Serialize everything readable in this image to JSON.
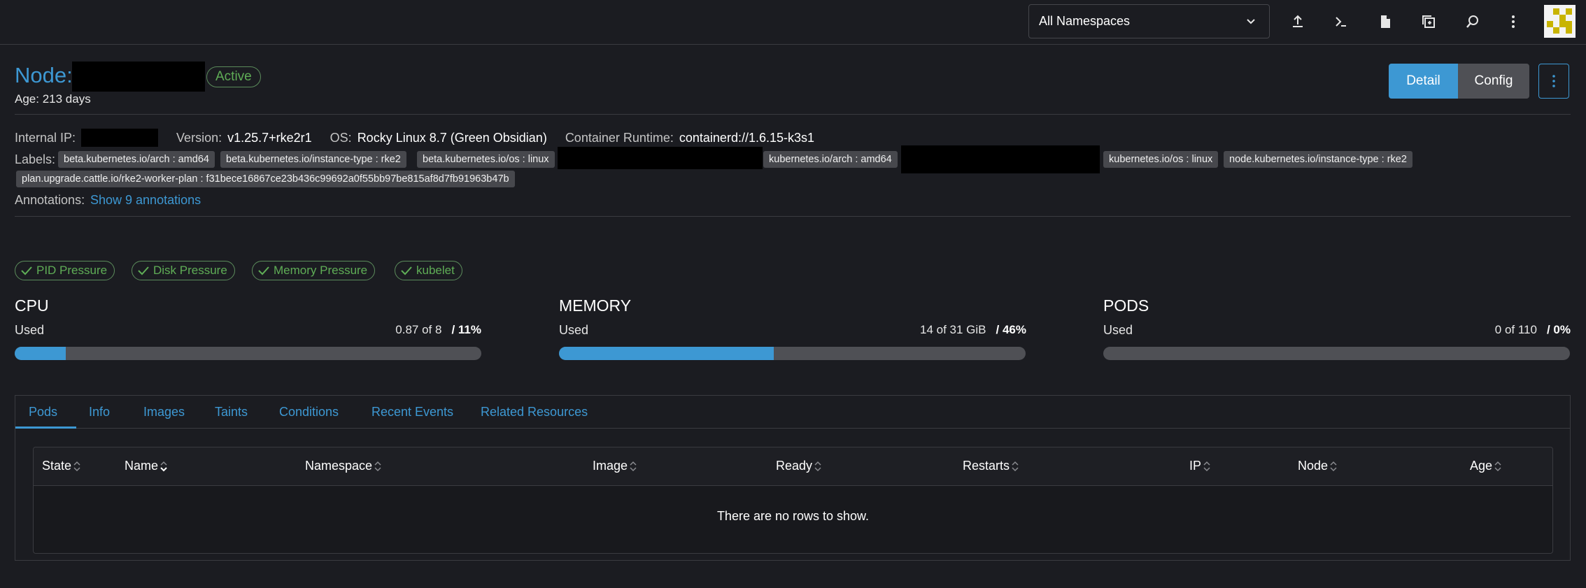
{
  "header": {
    "namespace_selector": "All Namespaces",
    "icons": [
      "upload-icon",
      "terminal-icon",
      "file-icon",
      "copy-icon",
      "search-icon",
      "more-vertical-icon"
    ]
  },
  "node": {
    "title_prefix": "Node:",
    "status": "Active",
    "age_label": "Age:",
    "age_value": "213 days"
  },
  "view_buttons": {
    "detail": "Detail",
    "config": "Config"
  },
  "info": {
    "internal_ip_label": "Internal IP:",
    "version_label": "Version:",
    "version_value": "v1.25.7+rke2r1",
    "os_label": "OS:",
    "os_value": "Rocky Linux 8.7 (Green Obsidian)",
    "runtime_label": "Container Runtime:",
    "runtime_value": "containerd://1.6.15-k3s1"
  },
  "labels": {
    "title": "Labels:",
    "items": [
      "beta.kubernetes.io/arch : amd64",
      "beta.kubernetes.io/instance-type : rke2",
      "beta.kubernetes.io/os : linux",
      "kubernetes.io/arch : amd64",
      "kubernetes.io/os : linux",
      "node.kubernetes.io/instance-type : rke2",
      "plan.upgrade.cattle.io/rke2-worker-plan : f31bece16867ce23b436c99692a0f55bb97be815af8d7fb91963b47b"
    ]
  },
  "annotations": {
    "title": "Annotations:",
    "link": "Show 9 annotations"
  },
  "conditions": [
    "PID Pressure",
    "Disk Pressure",
    "Memory Pressure",
    "kubelet"
  ],
  "gauges": [
    {
      "title": "CPU",
      "used_label": "Used",
      "amount": "0.87 of 8",
      "percent": "/ 11%",
      "fraction": 0.11
    },
    {
      "title": "MEMORY",
      "used_label": "Used",
      "amount": "14 of 31 GiB",
      "percent": "/ 46%",
      "fraction": 0.46
    },
    {
      "title": "PODS",
      "used_label": "Used",
      "amount": "0 of 110",
      "percent": "/ 0%",
      "fraction": 0
    }
  ],
  "tabs": [
    "Pods",
    "Info",
    "Images",
    "Taints",
    "Conditions",
    "Recent Events",
    "Related Resources"
  ],
  "table": {
    "columns": [
      "State",
      "Name",
      "Namespace",
      "Image",
      "Ready",
      "Restarts",
      "IP",
      "Node",
      "Age"
    ],
    "empty_message": "There are no rows to show."
  },
  "colors": {
    "accent": "#3d98d3",
    "success": "#5fad56",
    "background": "#1b1c21"
  }
}
